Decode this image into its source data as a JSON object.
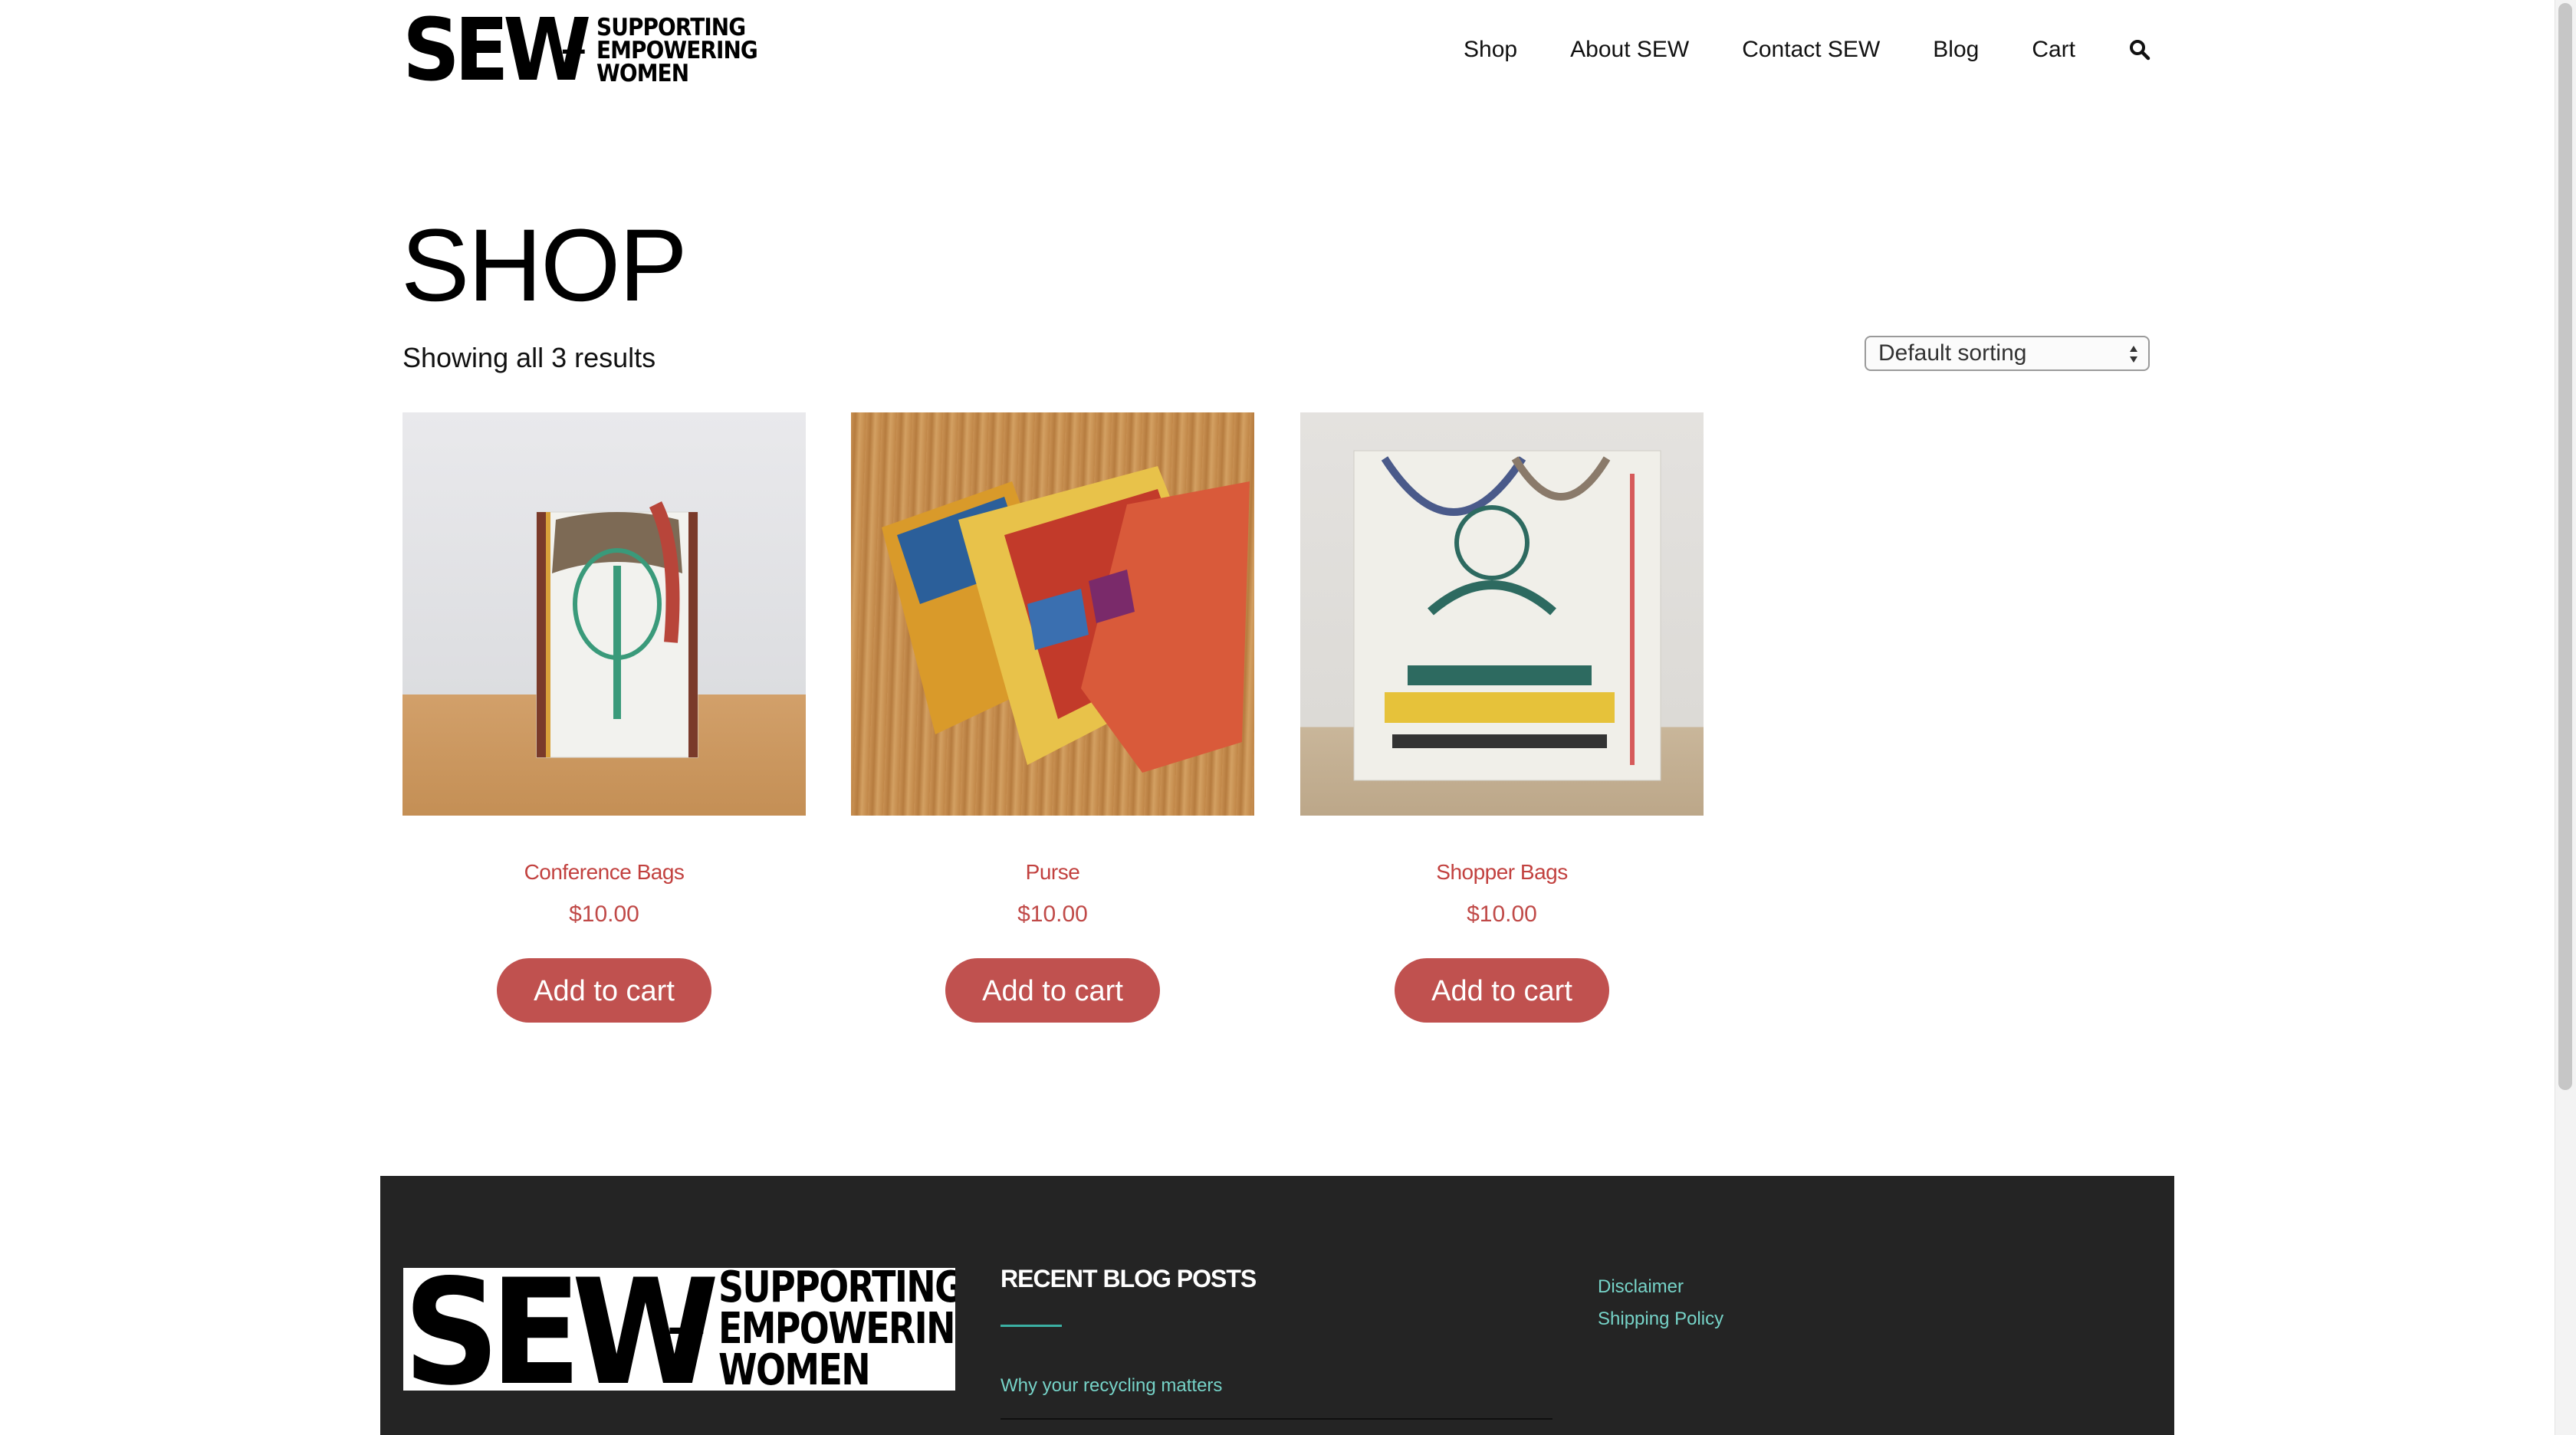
{
  "header": {
    "logo_main": "SEW",
    "logo_plus": "+",
    "logo_line1": "SUPPORTING",
    "logo_line2": "EMPOWERING",
    "logo_line3": "WOMEN",
    "nav": [
      "Shop",
      "About SEW",
      "Contact SEW",
      "Blog",
      "Cart"
    ],
    "search_icon": "search-icon"
  },
  "main": {
    "title": "SHOP",
    "result_count": "Showing all 3 results",
    "sort": {
      "selected": "Default sorting"
    }
  },
  "products": [
    {
      "name": "Conference Bags",
      "price": "$10.00",
      "button": "Add to cart",
      "image": "conference-bag-image"
    },
    {
      "name": "Purse",
      "price": "$10.00",
      "button": "Add to cart",
      "image": "purse-image"
    },
    {
      "name": "Shopper Bags",
      "price": "$10.00",
      "button": "Add to cart",
      "image": "shopper-bag-image"
    }
  ],
  "footer": {
    "logo_main": "SEW",
    "logo_plus": "+",
    "logo_line1": "SUPPORTING",
    "logo_line2": "EMPOWERING",
    "logo_line3": "WOMEN",
    "recent_title": "RECENT BLOG POSTS",
    "recent_posts": [
      "Why your recycling matters"
    ],
    "links": [
      "Disclaimer",
      "Shipping Policy"
    ]
  },
  "colors": {
    "accent": "#c0514f",
    "footer_bg": "#242424",
    "footer_link": "#76d3c8"
  }
}
